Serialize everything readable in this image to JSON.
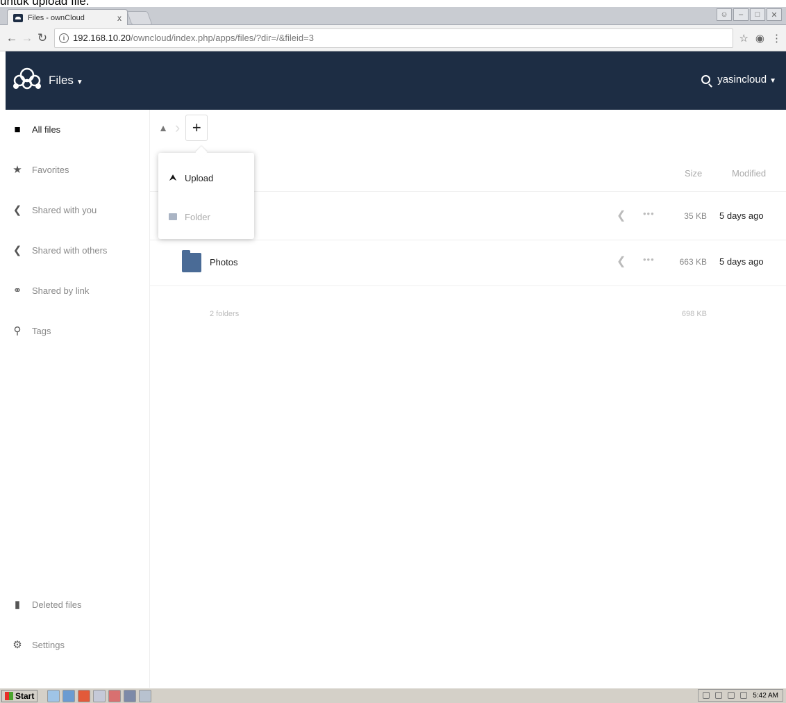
{
  "caption": {
    "text": "untuk upload file."
  },
  "browser": {
    "tab_title": "Files - ownCloud",
    "tab_close": "x",
    "url_host": "192.168.10.20",
    "url_path": "/owncloud/index.php/apps/files/?dir=/&fileid=3"
  },
  "header": {
    "app_title": "Files",
    "username": "yasincloud"
  },
  "sidebar": {
    "items": [
      {
        "label": "All files"
      },
      {
        "label": "Favorites"
      },
      {
        "label": "Shared with you"
      },
      {
        "label": "Shared with others"
      },
      {
        "label": "Shared by link"
      },
      {
        "label": "Tags"
      }
    ],
    "footer": [
      {
        "label": "Deleted files"
      },
      {
        "label": "Settings"
      }
    ]
  },
  "new_menu": {
    "upload_label": "Upload",
    "folder_label": "Folder"
  },
  "file_list": {
    "col_size": "Size",
    "col_modified": "Modified",
    "rows": [
      {
        "name": "",
        "size": "35 KB",
        "modified": "5 days ago"
      },
      {
        "name": "Photos",
        "size": "663 KB",
        "modified": "5 days ago"
      }
    ],
    "summary_label": "2 folders",
    "summary_size": "698 KB"
  },
  "taskbar": {
    "start_label": "Start",
    "clock": "5:42 AM"
  },
  "colors": {
    "header_bg": "#1d2d44",
    "folder": "#4a6b96"
  }
}
